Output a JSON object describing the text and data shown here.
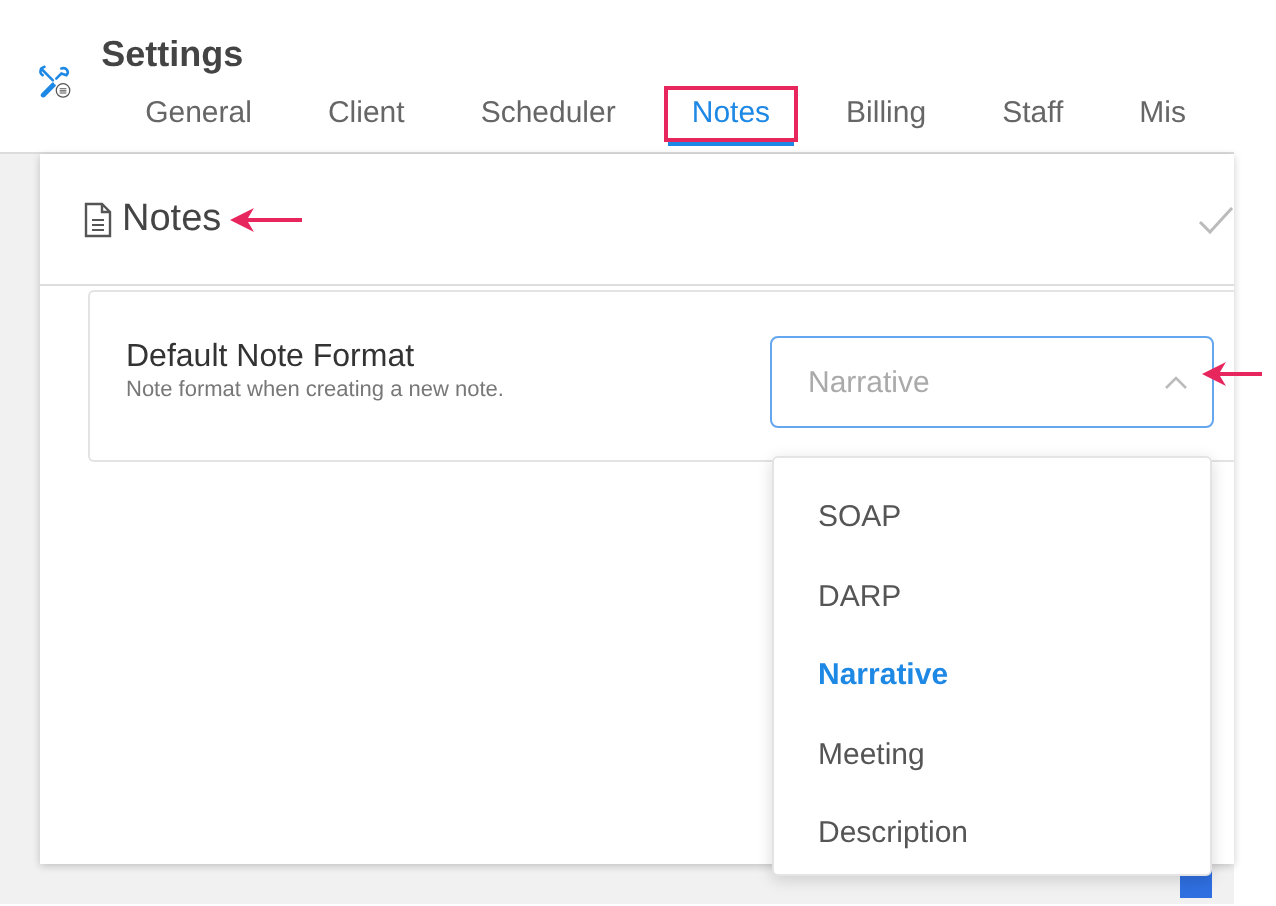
{
  "app": {
    "title": "Settings"
  },
  "tabs": [
    {
      "label": "General",
      "selected": false,
      "annotated": false
    },
    {
      "label": "Client",
      "selected": false,
      "annotated": false
    },
    {
      "label": "Scheduler",
      "selected": false,
      "annotated": false
    },
    {
      "label": "Notes",
      "selected": true,
      "annotated": true
    },
    {
      "label": "Billing",
      "selected": false,
      "annotated": false
    },
    {
      "label": "Staff",
      "selected": false,
      "annotated": false
    },
    {
      "label": "Mis",
      "selected": false,
      "annotated": false
    }
  ],
  "section": {
    "title": "Notes",
    "annotated": true
  },
  "setting": {
    "label": "Default Note Format",
    "description": "Note format when creating a new note.",
    "placeholder": "Narrative",
    "expanded": true,
    "annotated": true,
    "options": [
      {
        "label": "SOAP",
        "selected": false
      },
      {
        "label": "DARP",
        "selected": false
      },
      {
        "label": "Narrative",
        "selected": true
      },
      {
        "label": "Meeting",
        "selected": false
      },
      {
        "label": "Description",
        "selected": false
      }
    ]
  }
}
